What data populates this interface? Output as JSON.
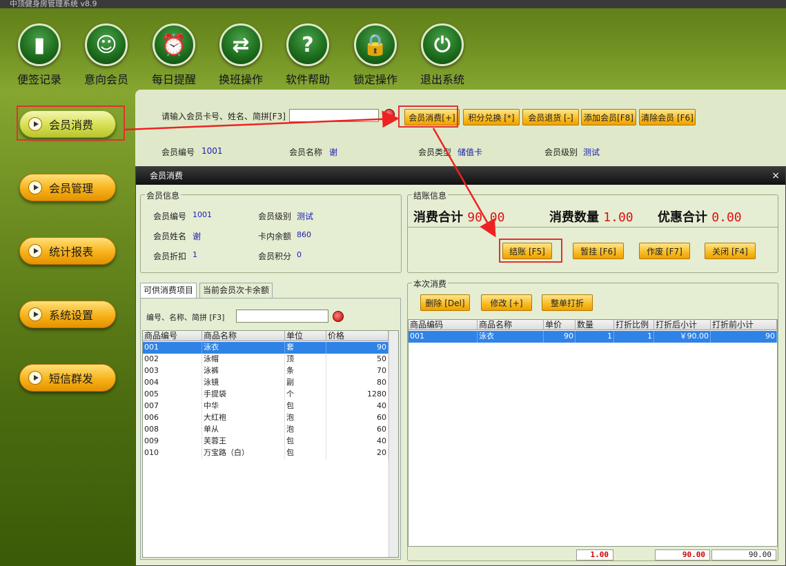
{
  "app_title": "中顶健身房管理系统  v8.9",
  "toolbar": [
    {
      "label": "便签记录",
      "icon": "note-icon",
      "glyph": "▮"
    },
    {
      "label": "意向会员",
      "icon": "person-icon",
      "glyph": "☺"
    },
    {
      "label": "每日提醒",
      "icon": "alarm-clock-icon",
      "glyph": "⏰"
    },
    {
      "label": "换班操作",
      "icon": "swap-arrows-icon",
      "glyph": "⇄"
    },
    {
      "label": "软件帮助",
      "icon": "help-icon",
      "glyph": "?"
    },
    {
      "label": "锁定操作",
      "icon": "lock-icon",
      "glyph": "🔒"
    },
    {
      "label": "退出系统",
      "icon": "power-icon",
      "glyph": "⏻"
    }
  ],
  "sidebar": [
    "会员消费",
    "会员管理",
    "统计报表",
    "系统设置",
    "短信群发"
  ],
  "search": {
    "label": "请输入会员卡号、姓名、简拼[F3]",
    "value": ""
  },
  "top_buttons": [
    "会员消费[+]",
    "积分兑换 [*]",
    "会员退货 [-]",
    "添加会员[F8]",
    "清除会员 [F6]"
  ],
  "top_info": {
    "no_label": "会员编号",
    "no_value": "1001",
    "name_label": "会员名称",
    "name_value": "谢",
    "type_label": "会员类型",
    "type_value": "储值卡",
    "level_label": "会员级别",
    "level_value": "测试"
  },
  "dialog": {
    "title": "会员消费",
    "close": "×",
    "member_group": "会员信息",
    "member": {
      "no_label": "会员编号",
      "no_value": "1001",
      "level_label": "会员级别",
      "level_value": "测试",
      "name_label": "会员姓名",
      "name_value": "谢",
      "balance_label": "卡内余额",
      "balance_value": "860",
      "discount_label": "会员折扣",
      "discount_value": "1",
      "points_label": "会员积分",
      "points_value": "0"
    },
    "checkout_group": "结账信息",
    "stats": {
      "total_label": "消费合计",
      "total_value": "90.00",
      "qty_label": "消费数量",
      "qty_value": "1.00",
      "disc_label": "优惠合计",
      "disc_value": "0.00"
    },
    "checkout_buttons": [
      "结账 [F5]",
      "暂挂 [F6]",
      "作废 [F7]",
      "关闭 [F4]"
    ],
    "tabs": [
      "可供消费项目",
      "当前会员次卡余额"
    ],
    "product_search_label": "编号、名称、简拼 [F3]",
    "product_search_value": "",
    "product_columns": [
      "商品编号",
      "商品名称",
      "单位",
      "价格"
    ],
    "products": [
      [
        "001",
        "泳衣",
        "套",
        "90"
      ],
      [
        "002",
        "泳帽",
        "顶",
        "50"
      ],
      [
        "003",
        "泳裤",
        "条",
        "70"
      ],
      [
        "004",
        "泳镜",
        "副",
        "80"
      ],
      [
        "005",
        "手提袋",
        "个",
        "1280"
      ],
      [
        "007",
        "中华",
        "包",
        "40"
      ],
      [
        "006",
        "大红袍",
        "泡",
        "60"
      ],
      [
        "008",
        "单从",
        "泡",
        "60"
      ],
      [
        "009",
        "芙蓉王",
        "包",
        "40"
      ],
      [
        "010",
        "万宝路（白）",
        "包",
        "20"
      ]
    ],
    "current_group": "本次消费",
    "current_buttons": [
      "删除 [Del]",
      "修改 [+]",
      "整单打折"
    ],
    "current_columns": [
      "商品编码",
      "商品名称",
      "单价",
      "数量",
      "打折比例",
      "打折后小计",
      "打折前小计"
    ],
    "current_rows": [
      [
        "001",
        "泳衣",
        "90",
        "1",
        "1",
        "￥90.00",
        "90"
      ]
    ],
    "footer": {
      "qty": "1.00",
      "after": "90.00",
      "before": "90.00"
    }
  }
}
